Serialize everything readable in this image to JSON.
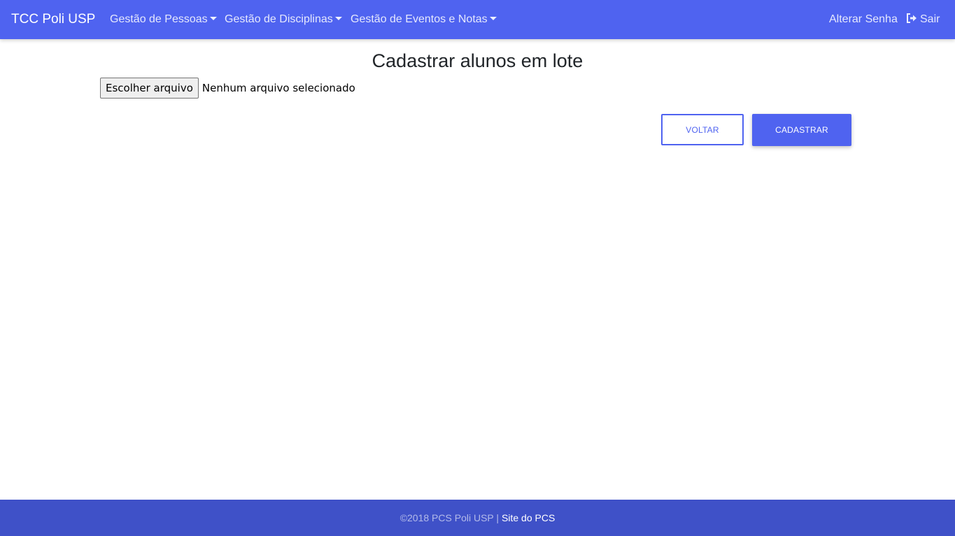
{
  "navbar": {
    "brand": "TCC Poli USP",
    "menus": [
      {
        "label": "Gestão de Pessoas"
      },
      {
        "label": "Gestão de Disciplinas"
      },
      {
        "label": "Gestão de Eventos e Notas"
      }
    ],
    "change_password": "Alterar Senha",
    "signout": "Sair",
    "signout_icon": "sign-out-icon",
    "caret_icon": "caret-down-icon"
  },
  "main": {
    "title": "Cadastrar alunos em lote",
    "file_input": {
      "button_label": "Escolher arquivo",
      "status": "Nenhum arquivo selecionado"
    },
    "back_button": "Voltar",
    "submit_button": "Cadastrar"
  },
  "footer": {
    "copyright": "©2018 PCS Poli USP |",
    "link": "Site do PCS"
  },
  "colors": {
    "primary": "#4f63f0",
    "footer": "#3f51c8"
  }
}
